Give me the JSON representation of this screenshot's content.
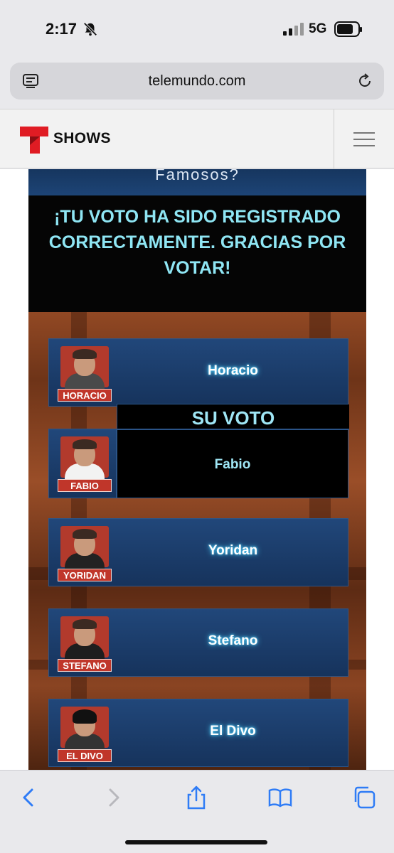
{
  "status_bar": {
    "time": "2:17",
    "network": "5G"
  },
  "browser": {
    "url": "telemundo.com"
  },
  "site_header": {
    "section": "SHOWS"
  },
  "page": {
    "partial_title": "Famosos?",
    "confirmation": "¡TU VOTO HA SIDO REGISTRADO CORRECTAMENTE. GRACIAS POR VOTAR!",
    "vote_box_title": "SU VOTO",
    "voted_name": "Fabio",
    "candidates": [
      {
        "name": "Horacio",
        "tag": "HORACIO"
      },
      {
        "name": "Fabio",
        "tag": "FABIO"
      },
      {
        "name": "Yoridan",
        "tag": "YORIDAN"
      },
      {
        "name": "Stefano",
        "tag": "STEFANO"
      },
      {
        "name": "El Divo",
        "tag": "EL DIVO"
      }
    ]
  },
  "colors": {
    "accent": "#8fe6f4",
    "row": "#1d4476",
    "logo_red": "#e01c24"
  }
}
